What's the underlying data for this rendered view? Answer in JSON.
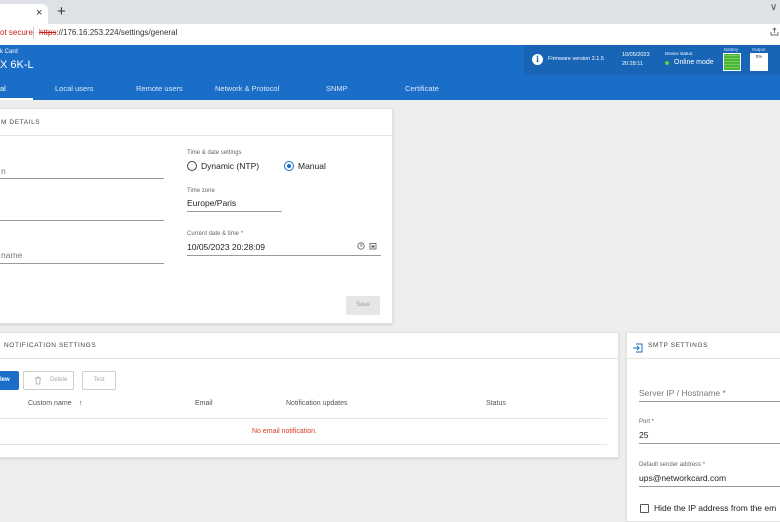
{
  "browser": {
    "tab_close": "×",
    "new_tab": "+",
    "tab_menu": "∨",
    "not_secure": "ot secure",
    "url_scheme": "https",
    "url_rest": "://176.16.253.224/settings/general"
  },
  "header": {
    "subtitle": "k Card",
    "title": "X 6K-L",
    "firmware_label": "Firmware version  2.1.5",
    "date": "10/05/2023",
    "time": "20:28:11",
    "device_status_label": "Device status:",
    "device_status_value": "Online mode",
    "device_status_color": "#62d23a",
    "battery_label": "Battery",
    "output_label": "Output",
    "output_value": "0%"
  },
  "nav": {
    "tabs": [
      {
        "label": "al",
        "active": true
      },
      {
        "label": "Local users",
        "active": false
      },
      {
        "label": "Remote users",
        "active": false
      },
      {
        "label": "Network & Protocol",
        "active": false
      },
      {
        "label": "SNMP",
        "active": false
      },
      {
        "label": "Certificate",
        "active": false
      }
    ]
  },
  "system_details": {
    "title": "M DETAILS",
    "field1_partial": "n",
    "field3_partial": "name",
    "time_date_label": "Time & date settings",
    "radio_ntp": "Dynamic (NTP)",
    "radio_manual": "Manual",
    "selected": "Manual",
    "timezone_label": "Time zone",
    "timezone_value": "Europe/Paris",
    "current_dt_label": "Current date & time *",
    "current_dt_value": "10/05/2023 20:28:09",
    "save_label": "Save"
  },
  "notifications": {
    "title": "NOTIFICATION SETTINGS",
    "new_label": "lew",
    "delete_label": "Delete",
    "test_label": "Test",
    "columns": [
      "Custom name",
      "Email",
      "Notification updates",
      "Status"
    ],
    "sort_arrow": "↑",
    "empty_message": "No email notification."
  },
  "smtp": {
    "title": "SMTP SETTINGS",
    "server_placeholder": "Server IP / Hostname *",
    "port_label": "Port *",
    "port_value": "25",
    "sender_label": "Default sender address *",
    "sender_value": "ups@networkcard.com",
    "hide_ip_label": "Hide the IP address from the em"
  },
  "colors": {
    "brand": "#1a6ec7",
    "error": "#d93a1f"
  }
}
